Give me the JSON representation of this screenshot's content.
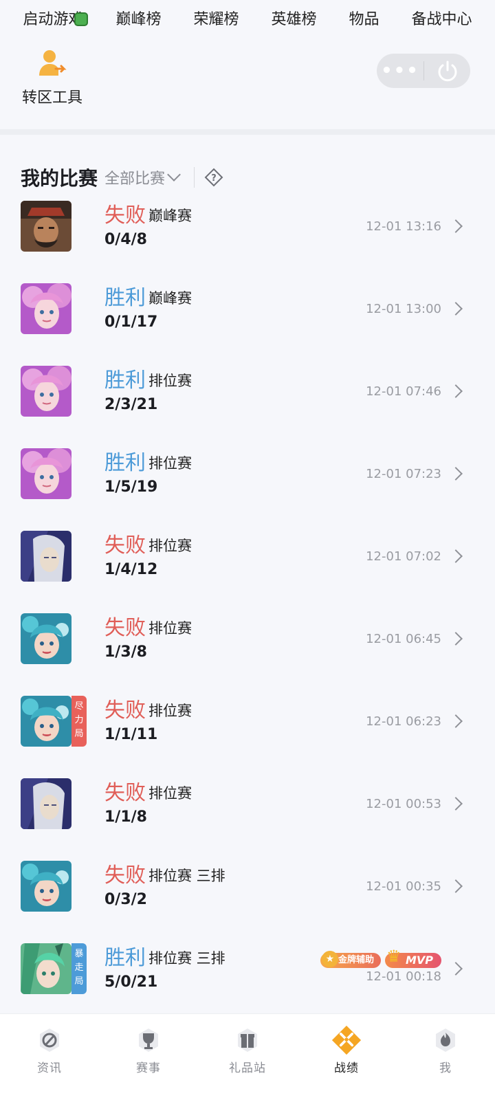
{
  "topnav": {
    "items": [
      "启动游戏",
      "巅峰榜",
      "荣耀榜",
      "英雄榜",
      "物品",
      "备战中心"
    ]
  },
  "tools": {
    "transfer_label": "转区工具",
    "more_label": "•••"
  },
  "section": {
    "title": "我的比赛",
    "filter_label": "全部比赛"
  },
  "matches": [
    {
      "result": "失败",
      "outcome": "lose",
      "mode": "巅峰赛",
      "kda": "0/4/8",
      "time": "12-01 13:16",
      "hero": "warrior",
      "tag": ""
    },
    {
      "result": "胜利",
      "outcome": "win",
      "mode": "巅峰赛",
      "kda": "0/1/17",
      "time": "12-01 13:00",
      "hero": "pink",
      "tag": ""
    },
    {
      "result": "胜利",
      "outcome": "win",
      "mode": "排位赛",
      "kda": "2/3/21",
      "time": "12-01 07:46",
      "hero": "pink",
      "tag": ""
    },
    {
      "result": "胜利",
      "outcome": "win",
      "mode": "排位赛",
      "kda": "1/5/19",
      "time": "12-01 07:23",
      "hero": "pink",
      "tag": ""
    },
    {
      "result": "失败",
      "outcome": "lose",
      "mode": "排位赛",
      "kda": "1/4/12",
      "time": "12-01 07:02",
      "hero": "silver",
      "tag": ""
    },
    {
      "result": "失败",
      "outcome": "lose",
      "mode": "排位赛",
      "kda": "1/3/8",
      "time": "12-01 06:45",
      "hero": "teal",
      "tag": ""
    },
    {
      "result": "失败",
      "outcome": "lose",
      "mode": "排位赛",
      "kda": "1/1/11",
      "time": "12-01 06:23",
      "hero": "teal",
      "tag": "尽力局"
    },
    {
      "result": "失败",
      "outcome": "lose",
      "mode": "排位赛",
      "kda": "1/1/8",
      "time": "12-01 00:53",
      "hero": "silver",
      "tag": ""
    },
    {
      "result": "失败",
      "outcome": "lose",
      "mode": "排位赛 三排",
      "kda": "0/3/2",
      "time": "12-01 00:35",
      "hero": "teal",
      "tag": ""
    },
    {
      "result": "胜利",
      "outcome": "win",
      "mode": "排位赛 三排",
      "kda": "5/0/21",
      "time": "12-01 00:18",
      "hero": "green",
      "tag": "暴走局",
      "badges": [
        "金牌辅助",
        "MVP"
      ]
    }
  ],
  "tabbar": {
    "items": [
      {
        "label": "资讯",
        "icon": "news-icon",
        "active": false
      },
      {
        "label": "赛事",
        "icon": "trophy-icon",
        "active": false
      },
      {
        "label": "礼品站",
        "icon": "gift-icon",
        "active": false
      },
      {
        "label": "战绩",
        "icon": "swords-icon",
        "active": true
      },
      {
        "label": "我",
        "icon": "profile-icon",
        "active": false
      }
    ]
  },
  "colors": {
    "win": "#4d9bd8",
    "lose": "#e05e58",
    "accent": "#f5a623",
    "background": "#f6f7fb"
  }
}
